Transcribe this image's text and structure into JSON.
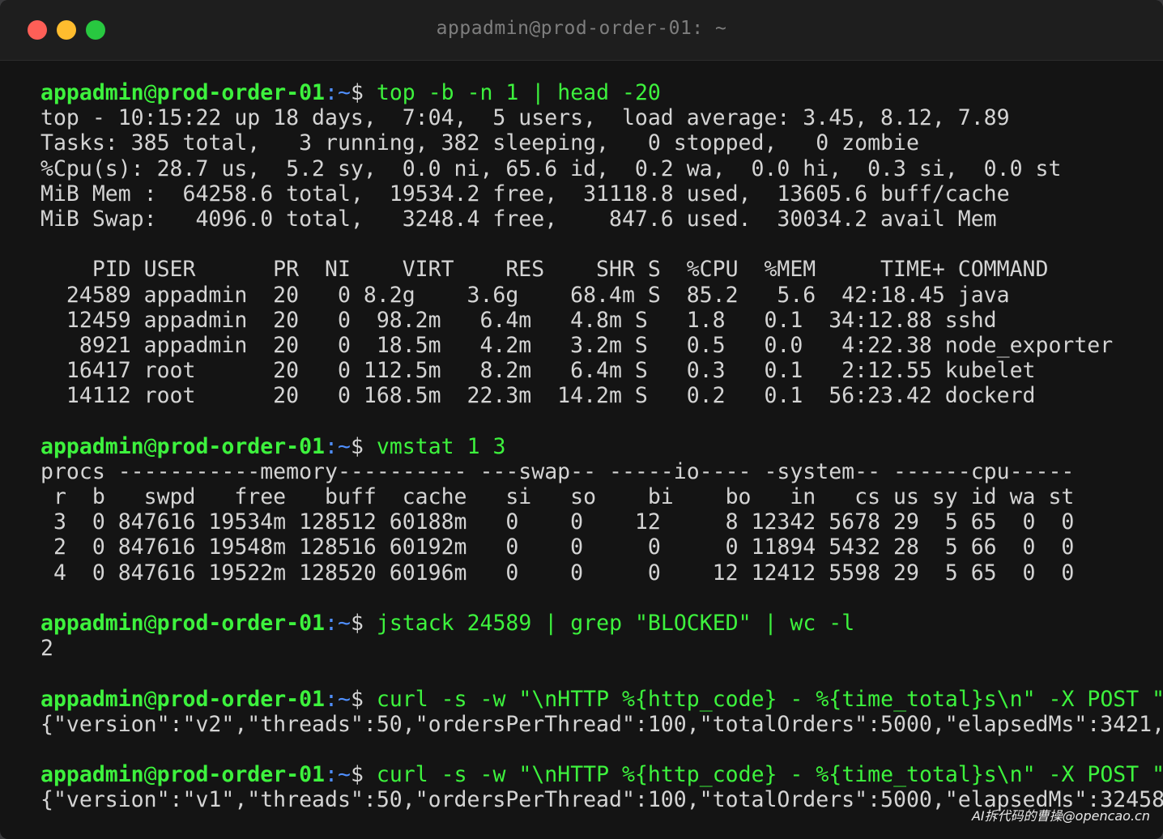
{
  "window": {
    "title": "appadmin@prod-order-01: ~"
  },
  "prompt": {
    "user": "appadmin",
    "at": "@",
    "host": "prod-order-01",
    "colon": ":",
    "path": "~",
    "dollar": "$ "
  },
  "colors": {
    "prompt_green": "#3df23d",
    "path_blue": "#4f8fff",
    "text": "#d4d4d4",
    "background": "#141414",
    "close": "#fe5f57",
    "minimize": "#febc2e",
    "zoom": "#28c840"
  },
  "terminal": [
    {
      "type": "prompt",
      "cmd": "top -b -n 1 | head -20"
    },
    {
      "type": "out",
      "text": "top - 10:15:22 up 18 days,  7:04,  5 users,  load average: 3.45, 8.12, 7.89"
    },
    {
      "type": "out",
      "text": "Tasks: 385 total,   3 running, 382 sleeping,   0 stopped,   0 zombie"
    },
    {
      "type": "out",
      "text": "%Cpu(s): 28.7 us,  5.2 sy,  0.0 ni, 65.6 id,  0.2 wa,  0.0 hi,  0.3 si,  0.0 st"
    },
    {
      "type": "out",
      "text": "MiB Mem :  64258.6 total,  19534.2 free,  31118.8 used,  13605.6 buff/cache"
    },
    {
      "type": "out",
      "text": "MiB Swap:   4096.0 total,   3248.4 free,    847.6 used.  30034.2 avail Mem"
    },
    {
      "type": "out",
      "text": ""
    },
    {
      "type": "out",
      "text": "    PID USER      PR  NI    VIRT    RES    SHR S  %CPU  %MEM     TIME+ COMMAND"
    },
    {
      "type": "out",
      "text": "  24589 appadmin  20   0 8.2g    3.6g    68.4m S  85.2   5.6  42:18.45 java"
    },
    {
      "type": "out",
      "text": "  12459 appadmin  20   0  98.2m   6.4m   4.8m S   1.8   0.1  34:12.88 sshd"
    },
    {
      "type": "out",
      "text": "   8921 appadmin  20   0  18.5m   4.2m   3.2m S   0.5   0.0   4:22.38 node_exporter"
    },
    {
      "type": "out",
      "text": "  16417 root      20   0 112.5m   8.2m   6.4m S   0.3   0.1   2:12.55 kubelet"
    },
    {
      "type": "out",
      "text": "  14112 root      20   0 168.5m  22.3m  14.2m S   0.2   0.1  56:23.42 dockerd"
    },
    {
      "type": "out",
      "text": ""
    },
    {
      "type": "prompt",
      "cmd": "vmstat 1 3"
    },
    {
      "type": "out",
      "text": "procs -----------memory---------- ---swap-- -----io---- -system-- ------cpu-----"
    },
    {
      "type": "out",
      "text": " r  b   swpd   free   buff  cache   si   so    bi    bo   in   cs us sy id wa st"
    },
    {
      "type": "out",
      "text": " 3  0 847616 19534m 128512 60188m   0    0    12     8 12342 5678 29  5 65  0  0"
    },
    {
      "type": "out",
      "text": " 2  0 847616 19548m 128516 60192m   0    0     0     0 11894 5432 28  5 66  0  0"
    },
    {
      "type": "out",
      "text": " 4  0 847616 19522m 128520 60196m   0    0     0    12 12412 5598 29  5 65  0  0"
    },
    {
      "type": "out",
      "text": ""
    },
    {
      "type": "prompt",
      "cmd": "jstack 24589 | grep \"BLOCKED\" | wc -l"
    },
    {
      "type": "out",
      "text": "2"
    },
    {
      "type": "out",
      "text": ""
    },
    {
      "type": "prompt",
      "cmd": "curl -s -w \"\\nHTTP %{http_code} - %{time_total}s\\n\" -X POST \""
    },
    {
      "type": "out",
      "text": "{\"version\":\"v2\",\"threads\":50,\"ordersPerThread\":100,\"totalOrders\":5000,\"elapsedMs\":3421,"
    },
    {
      "type": "out",
      "text": ""
    },
    {
      "type": "prompt",
      "cmd": "curl -s -w \"\\nHTTP %{http_code} - %{time_total}s\\n\" -X POST \""
    },
    {
      "type": "out",
      "text": "{\"version\":\"v1\",\"threads\":50,\"ordersPerThread\":100,\"totalOrders\":5000,\"elapsedMs\":32458"
    }
  ],
  "watermark": "AI拆代码的曹操@opencao.cn"
}
